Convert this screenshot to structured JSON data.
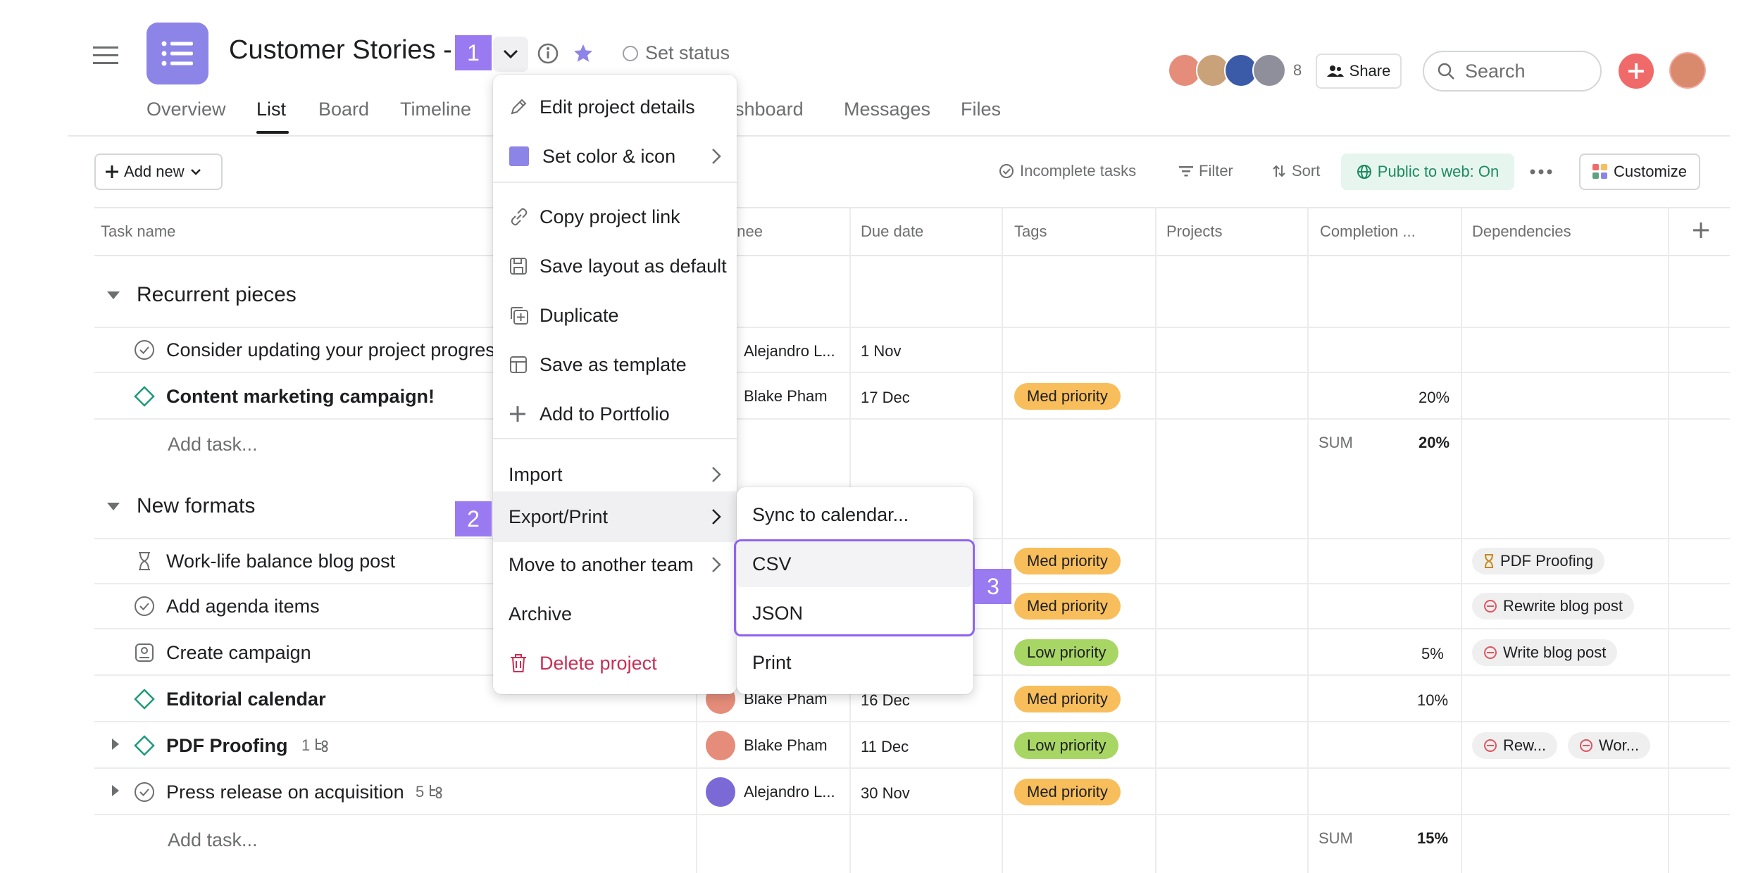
{
  "project": {
    "title": "Customer Stories - ",
    "status_label": "Set status"
  },
  "header": {
    "member_count": "8",
    "share_label": "Share",
    "search_placeholder": "Search"
  },
  "tabs": [
    "Overview",
    "List",
    "Board",
    "Timeline",
    "ashboard",
    "Messages",
    "Files"
  ],
  "active_tab": "List",
  "toolbar": {
    "add_new": "Add new",
    "incomplete": "Incomplete tasks",
    "filter": "Filter",
    "sort": "Sort",
    "public": "Public to web: On",
    "customize": "Customize"
  },
  "columns": {
    "task_name": "Task name",
    "assignee": "gnee",
    "due_date": "Due date",
    "tags": "Tags",
    "projects": "Projects",
    "completion": "Completion ...",
    "dependencies": "Dependencies"
  },
  "sections": [
    {
      "title": "Recurrent pieces",
      "tasks": [
        {
          "name": "Consider updating your project progres",
          "assignee": "Alejandro L...",
          "due": "1 Nov",
          "tag": "",
          "completion": "",
          "dependencies": []
        },
        {
          "name": "Content marketing campaign!",
          "assignee": "Blake Pham",
          "due": "17 Dec",
          "tag": "Med priority",
          "completion": "20%",
          "dependencies": []
        }
      ],
      "add_task": "Add task...",
      "sum_label": "SUM",
      "sum_value": "20%"
    },
    {
      "title": "New formats",
      "tasks": [
        {
          "name": "Work-life balance blog post",
          "assignee": "",
          "due": "",
          "tag": "Med priority",
          "completion": "",
          "dependencies": [
            "PDF Proofing"
          ]
        },
        {
          "name": "Add agenda items",
          "assignee": "",
          "due": "",
          "tag": "Med priority",
          "completion": "",
          "dependencies": [
            "Rewrite blog post"
          ]
        },
        {
          "name": "Create campaign",
          "assignee": "",
          "due": "",
          "tag": "Low priority",
          "completion": "5%",
          "dependencies": [
            "Write blog post"
          ]
        },
        {
          "name": "Editorial calendar",
          "assignee": "Blake Pham",
          "due": "16 Dec",
          "tag": "Med priority",
          "completion": "10%",
          "dependencies": []
        },
        {
          "name": "PDF Proofing",
          "subtasks": "1",
          "assignee": "Blake Pham",
          "due": "11 Dec",
          "tag": "Low priority",
          "completion": "",
          "dependencies": [
            "Rew...",
            "Wor..."
          ]
        },
        {
          "name": "Press release on acquisition",
          "subtasks": "5",
          "assignee": "Alejandro L...",
          "due": "30 Nov",
          "tag": "Med priority",
          "completion": "",
          "dependencies": []
        }
      ],
      "add_task": "Add task...",
      "sum_label": "SUM",
      "sum_value": "15%"
    }
  ],
  "project_menu": {
    "items": [
      {
        "label": "Edit project details",
        "icon": "pencil-icon"
      },
      {
        "label": "Set color & icon",
        "icon": "color-swatch-icon"
      },
      {
        "label": "Copy project link",
        "icon": "link-icon"
      },
      {
        "label": "Save layout as default",
        "icon": "save-layout-icon"
      },
      {
        "label": "Duplicate",
        "icon": "duplicate-icon"
      },
      {
        "label": "Save as template",
        "icon": "template-icon"
      },
      {
        "label": "Add to Portfolio",
        "icon": "plus-icon"
      },
      {
        "label": "Import",
        "icon": ""
      },
      {
        "label": "Export/Print",
        "icon": ""
      },
      {
        "label": "Move to another team",
        "icon": ""
      },
      {
        "label": "Archive",
        "icon": ""
      },
      {
        "label": "Delete project",
        "icon": "trash-icon"
      }
    ]
  },
  "export_submenu": {
    "items": [
      "Sync to calendar...",
      "CSV",
      "JSON",
      "Print"
    ]
  },
  "step_badges": [
    "1",
    "2",
    "3"
  ],
  "colors": {
    "accent": "#8d84e8",
    "med_priority": "#f8be5c",
    "low_priority": "#a8d665",
    "danger": "#c92f54",
    "public_green": "#1d8a5f",
    "badge_purple": "#9a7af0",
    "highlight_border": "#8d63f0"
  }
}
